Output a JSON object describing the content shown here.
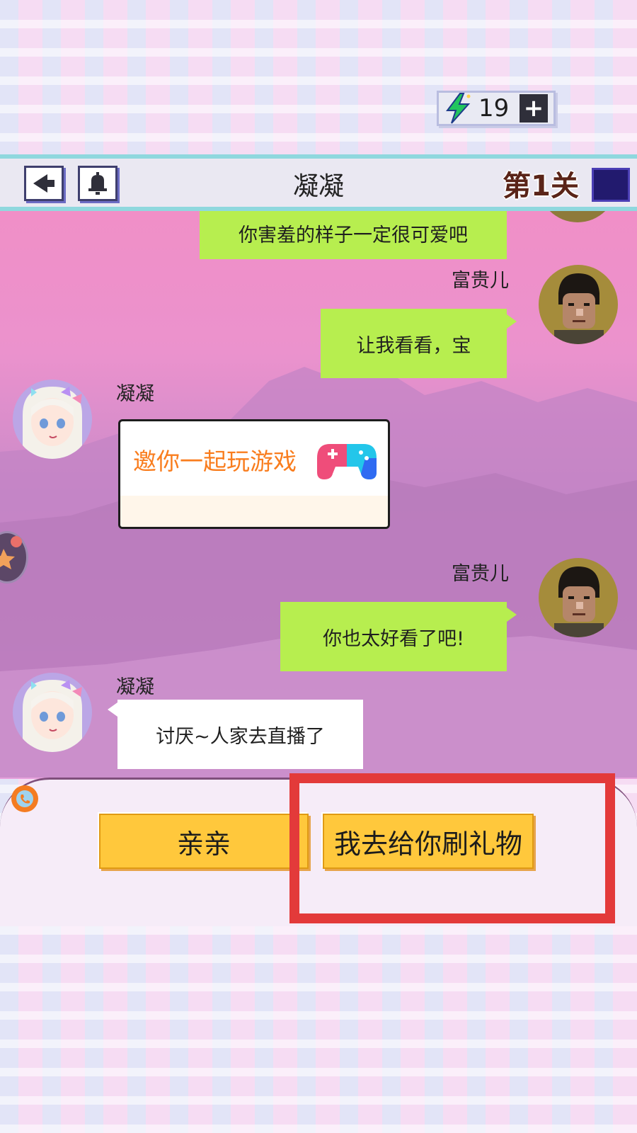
{
  "energy": {
    "value": "19",
    "plus_label": "+"
  },
  "header": {
    "title": "凝凝",
    "level": "第1关"
  },
  "chat": {
    "messages": [
      {
        "text": "你害羞的样子一定很可爱吧"
      },
      {
        "sender": "富贵儿",
        "text": "让我看看，宝"
      },
      {
        "sender": "凝凝",
        "card_text": "邀你一起玩游戏"
      },
      {
        "sender": "富贵儿",
        "text": "你也太好看了吧!"
      },
      {
        "sender": "凝凝",
        "text": "讨厌~人家去直播了"
      }
    ]
  },
  "replies": {
    "option1": "亲亲",
    "option2": "我去给你刷礼物"
  },
  "colors": {
    "highlight": "#e33a3a",
    "my_bubble": "#b7ee4f",
    "option_button": "#ffc83c"
  }
}
